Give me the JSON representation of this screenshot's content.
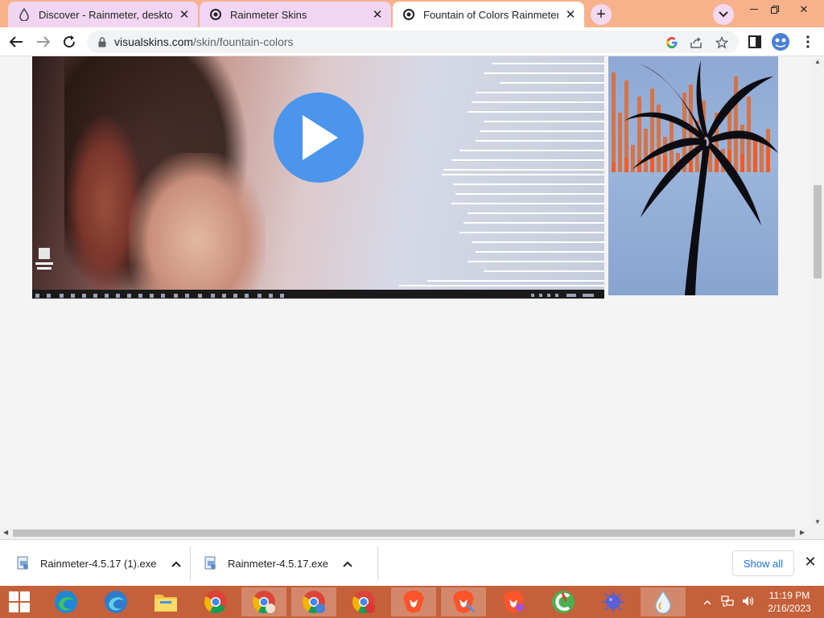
{
  "browser": {
    "tabs": [
      {
        "title": "Discover - Rainmeter, desktop cu",
        "active": false,
        "favicon": "rainmeter-drop-icon"
      },
      {
        "title": "Rainmeter Skins",
        "active": false,
        "favicon": "gear-icon"
      },
      {
        "title": "Fountain of Colors Rainmeter Ski",
        "active": true,
        "favicon": "gear-icon"
      }
    ],
    "new_tab_label": "+",
    "address": {
      "domain": "visualskins.com",
      "path": "/skin/fountain-colors"
    },
    "colors": {
      "tabstrip": "#f7b28b",
      "inactive_tab": "#f1d5f3",
      "link_blue": "#1a73e8"
    }
  },
  "page": {
    "video_play_icon": "play-icon",
    "thumbnail_subject": "palm-tree-visualizer-icon"
  },
  "downloads": {
    "items": [
      {
        "name": "Rainmeter-4.5.17 (1).exe"
      },
      {
        "name": "Rainmeter-4.5.17.exe"
      }
    ],
    "show_all_label": "Show all"
  },
  "taskbar": {
    "apps": [
      {
        "name": "edge-icon",
        "open": false
      },
      {
        "name": "edge-beta-icon",
        "open": false
      },
      {
        "name": "file-explorer-icon",
        "open": false
      },
      {
        "name": "chrome-icon",
        "open": false
      },
      {
        "name": "chrome-profile-icon",
        "open": true
      },
      {
        "name": "chrome-profile-2-icon",
        "open": true
      },
      {
        "name": "chrome-profile-3-icon",
        "open": false
      },
      {
        "name": "brave-icon",
        "open": true
      },
      {
        "name": "brave-2-icon",
        "open": true
      },
      {
        "name": "brave-3-icon",
        "open": false
      },
      {
        "name": "ccleaner-icon",
        "open": false
      },
      {
        "name": "virus-app-icon",
        "open": false
      },
      {
        "name": "rainmeter-icon",
        "open": true
      }
    ],
    "clock": {
      "time": "11:19 PM",
      "date": "2/16/2023"
    }
  }
}
